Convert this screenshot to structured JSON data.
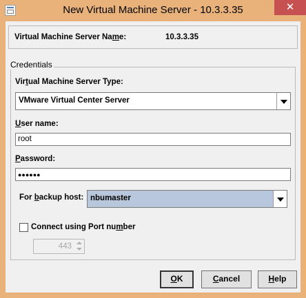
{
  "window": {
    "title": "New Virtual Machine Server - 10.3.3.35",
    "close_symbol": "✕",
    "colors": {
      "titlebar": "#e8b27a",
      "close": "#c75050",
      "highlight": "#b8c7db"
    }
  },
  "server_name": {
    "label_parts": [
      "Virtual Machine Server Na",
      "m",
      "e:"
    ],
    "value": "10.3.3.35"
  },
  "credentials": {
    "legend": "Credentials",
    "server_type": {
      "label_parts": [
        "Vir",
        "t",
        "ual Machine Server Type:"
      ],
      "selected": "VMware Virtual Center Server"
    },
    "username": {
      "label_parts": [
        "",
        "U",
        "ser name:"
      ],
      "value": "root"
    },
    "password": {
      "label_parts": [
        "",
        "P",
        "assword:"
      ],
      "masked_value": "●●●●●●"
    },
    "backup_host": {
      "label_parts": [
        "For ",
        "b",
        "ackup host:"
      ],
      "selected": "nbumaster"
    },
    "port": {
      "checkbox_label_parts": [
        "Connect using Port nu",
        "m",
        "ber"
      ],
      "checked": false,
      "value": "443"
    }
  },
  "buttons": {
    "ok_parts": [
      "",
      "O",
      "K"
    ],
    "cancel_parts": [
      "",
      "C",
      "ancel"
    ],
    "help_parts": [
      "",
      "H",
      "elp"
    ]
  },
  "icons": [
    "app-icon",
    "close-icon",
    "dropdown-arrow-icon",
    "spin-up-icon",
    "spin-down-icon"
  ]
}
